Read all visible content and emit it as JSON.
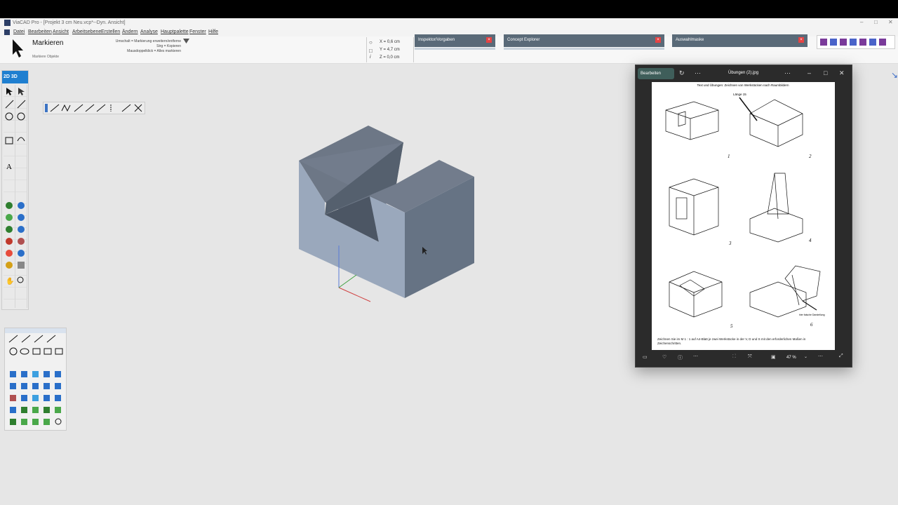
{
  "app": {
    "title": "ViaCAD Pro - [Projekt 3 cm Neu.vcp*--Dyn. Ansicht]",
    "window_controls": [
      "–",
      "□",
      "✕"
    ],
    "menu": [
      "Datei",
      "Bearbeiten",
      "Ansicht",
      "Arbeitsebene",
      "Erstellen",
      "Ändern",
      "Analyse",
      "Hauptpalette",
      "Fenster",
      "Hilfe"
    ]
  },
  "tool": {
    "name": "Markieren",
    "subtitle": "Markiere Objekte",
    "hints": [
      "Umschalt = Markierung erweitern/entferne",
      "Strg = Kopieren",
      "Mausdoppelklick = Alles markieren"
    ]
  },
  "coords": {
    "x": "X = 0,6 cm",
    "y": "Y = 4,7 cm",
    "z": "Z = 0,0 cm"
  },
  "palettes": [
    {
      "label": "Inspektor/Vorgaben"
    },
    {
      "label": "Concept Explorer"
    },
    {
      "label": "Auswahlmaske"
    }
  ],
  "left_toolbar": {
    "header": "2D 3D"
  },
  "photos": {
    "edit_label": "Bearbeiten",
    "filename": "Übungen (2).jpg",
    "zoom": "47 %",
    "doc_title": "Text und Übungen: Zeichnen von Werkstücken nach Raumbildern",
    "doc_callout_top": "Länge 15",
    "doc_callout_bottom": "hier falsche Darstellung",
    "numbers": [
      "1",
      "2",
      "3",
      "4",
      "5",
      "6"
    ],
    "footer": "Zeichnen Sie im M 1 : 1 auf A4-Blatt je zwei Werkstücke in der V, D und S mit den erforderlichen Maßen in Zeichenschritten."
  },
  "colors": {
    "accent": "#1f7fd0",
    "palette_bg": "#5a6a78",
    "solid_top": "#6e7888",
    "solid_front": "#9aa8bc",
    "solid_side": "#667384"
  }
}
